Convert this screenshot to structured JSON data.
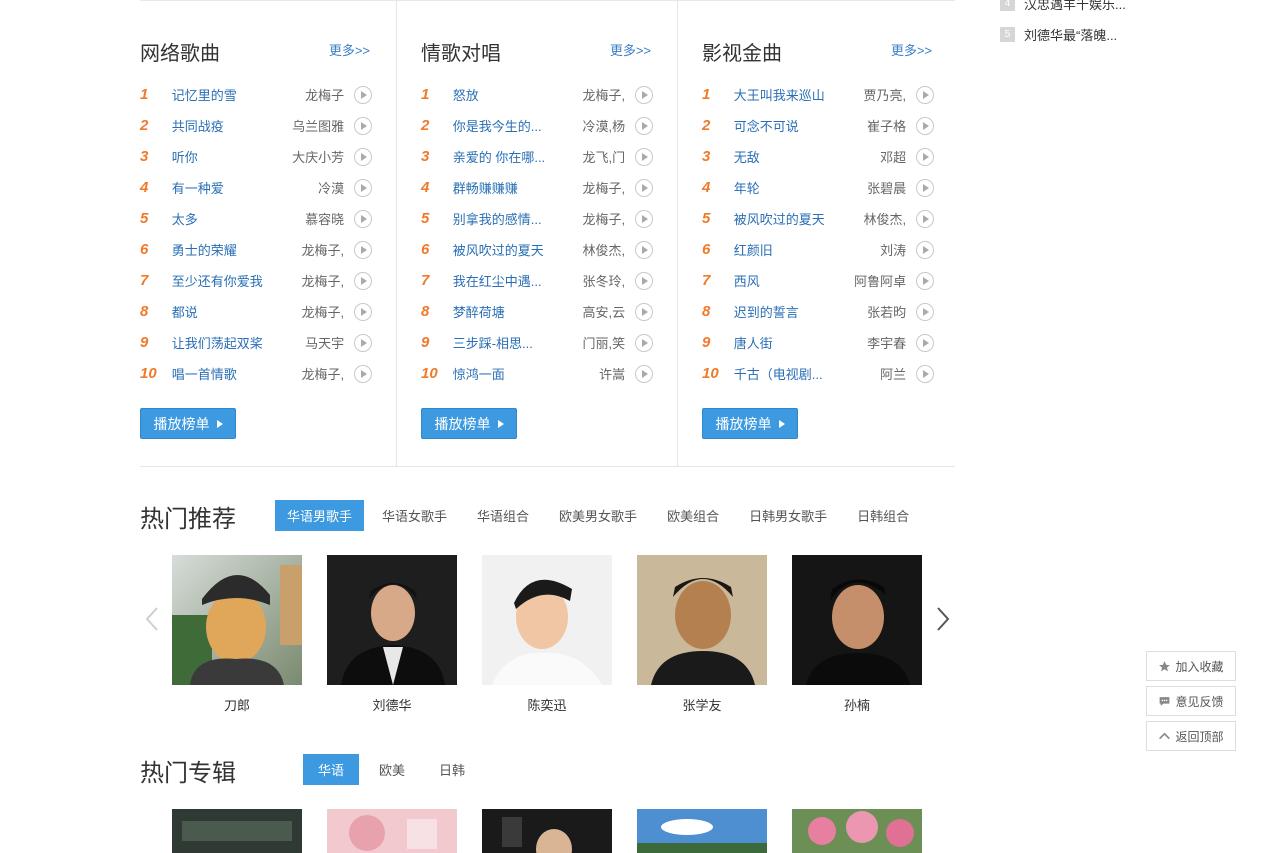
{
  "news": [
    {
      "rank": "4",
      "text": "汉忠遇羊千娱乐..."
    },
    {
      "rank": "5",
      "text": "刘德华最“落魄..."
    }
  ],
  "charts": [
    {
      "title": "网络歌曲",
      "more": "更多>>",
      "songs": [
        {
          "rank": "1",
          "name": "记忆里的雪",
          "artist": "龙梅子"
        },
        {
          "rank": "2",
          "name": "共同战疫",
          "artist": "乌兰图雅"
        },
        {
          "rank": "3",
          "name": "听你",
          "artist": "大庆小芳"
        },
        {
          "rank": "4",
          "name": "有一种爱",
          "artist": "冷漠"
        },
        {
          "rank": "5",
          "name": "太多",
          "artist": "慕容晓"
        },
        {
          "rank": "6",
          "name": "勇士的荣耀",
          "artist": "龙梅子,"
        },
        {
          "rank": "7",
          "name": "至少还有你爱我",
          "artist": "龙梅子,"
        },
        {
          "rank": "8",
          "name": "都说",
          "artist": "龙梅子,"
        },
        {
          "rank": "9",
          "name": "让我们荡起双桨",
          "artist": "马天宇"
        },
        {
          "rank": "10",
          "name": "唱一首情歌",
          "artist": "龙梅子,"
        }
      ],
      "play_label": "播放榜单"
    },
    {
      "title": "情歌对唱",
      "more": "更多>>",
      "songs": [
        {
          "rank": "1",
          "name": "怒放",
          "artist": "龙梅子,"
        },
        {
          "rank": "2",
          "name": "你是我今生的...",
          "artist": "冷漠,杨"
        },
        {
          "rank": "3",
          "name": "亲爱的 你在哪...",
          "artist": "龙飞,门"
        },
        {
          "rank": "4",
          "name": "群畅赚赚赚",
          "artist": "龙梅子,"
        },
        {
          "rank": "5",
          "name": "别拿我的感情...",
          "artist": "龙梅子,"
        },
        {
          "rank": "6",
          "name": "被风吹过的夏天",
          "artist": "林俊杰,"
        },
        {
          "rank": "7",
          "name": "我在红尘中遇...",
          "artist": "张冬玲,"
        },
        {
          "rank": "8",
          "name": "梦醉荷塘",
          "artist": "高安,云"
        },
        {
          "rank": "9",
          "name": "三步踩-相思...",
          "artist": "门丽,笑"
        },
        {
          "rank": "10",
          "name": "惊鸿一面",
          "artist": "许嵩"
        }
      ],
      "play_label": "播放榜单"
    },
    {
      "title": "影视金曲",
      "more": "更多>>",
      "songs": [
        {
          "rank": "1",
          "name": "大王叫我来巡山",
          "artist": "贾乃亮,"
        },
        {
          "rank": "2",
          "name": "可念不可说",
          "artist": "崔子格"
        },
        {
          "rank": "3",
          "name": "无敌",
          "artist": "邓超"
        },
        {
          "rank": "4",
          "name": "年轮",
          "artist": "张碧晨"
        },
        {
          "rank": "5",
          "name": "被风吹过的夏天",
          "artist": "林俊杰,"
        },
        {
          "rank": "6",
          "name": "红颜旧",
          "artist": "刘涛"
        },
        {
          "rank": "7",
          "name": "西风",
          "artist": "阿鲁阿卓"
        },
        {
          "rank": "8",
          "name": "迟到的誓言",
          "artist": "张若昀"
        },
        {
          "rank": "9",
          "name": "唐人街",
          "artist": "李宇春"
        },
        {
          "rank": "10",
          "name": "千古（电视剧...",
          "artist": "阿兰"
        }
      ],
      "play_label": "播放榜单"
    }
  ],
  "hot_recommend": {
    "title": "热门推荐",
    "tabs": [
      "华语男歌手",
      "华语女歌手",
      "华语组合",
      "欧美男女歌手",
      "欧美组合",
      "日韩男女歌手",
      "日韩组合"
    ],
    "artists": [
      "刀郎",
      "刘德华",
      "陈奕迅",
      "张学友",
      "孙楠"
    ]
  },
  "hot_albums": {
    "title": "热门专辑",
    "tabs": [
      "华语",
      "欧美",
      "日韩"
    ]
  },
  "side_tools": {
    "favorite": "加入收藏",
    "feedback": "意见反馈",
    "top": "返回顶部"
  },
  "colors": {
    "accent": "#3d9ae0",
    "rank": "#f07a2a",
    "link": "#2a6fb5"
  }
}
